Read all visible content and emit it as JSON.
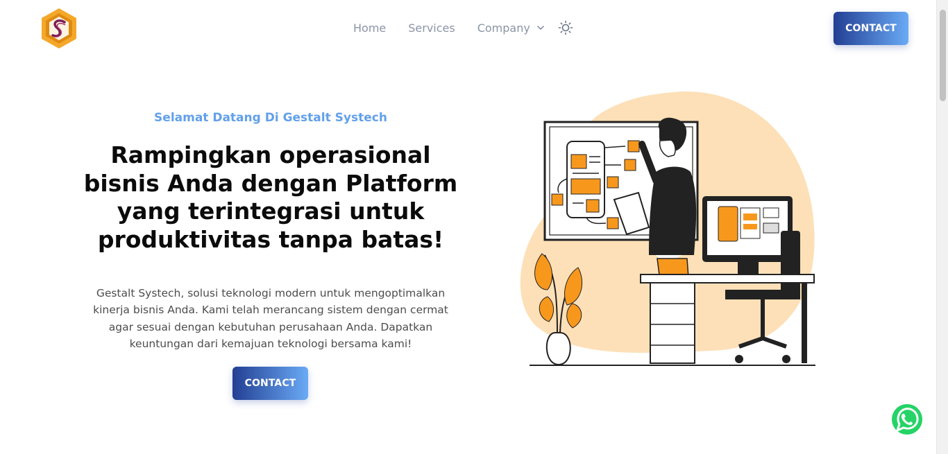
{
  "header": {
    "logo_icon": "gestalt-systech-logo",
    "nav": [
      {
        "label": "Home"
      },
      {
        "label": "Services"
      },
      {
        "label": "Company"
      }
    ],
    "theme_icon": "sun-icon",
    "contact_label": "CONTACT"
  },
  "hero": {
    "tagline": "Selamat Datang Di Gestalt Systech",
    "headline": "Rampingkan operasional bisnis Anda dengan Platform yang terintegrasi untuk produktivitas tanpa batas!",
    "description": "Gestalt Systech, solusi teknologi modern untuk mengoptimalkan kinerja bisnis Anda. Kami telah merancang sistem dengan cermat agar sesuai dengan kebutuhan perusahaan Anda. Dapatkan keuntungan dari kemajuan teknologi bersama kami!",
    "contact_label": "CONTACT",
    "illustration": "person-planning-illustration"
  },
  "floating": {
    "whatsapp_icon": "whatsapp-icon"
  },
  "colors": {
    "accent_gradient_start": "#233f93",
    "accent_gradient_end": "#6aaaf5",
    "tagline": "#62a0ea",
    "illustration_orange": "#f7981d",
    "illustration_blob": "#fde0b8",
    "whatsapp": "#25d366"
  }
}
